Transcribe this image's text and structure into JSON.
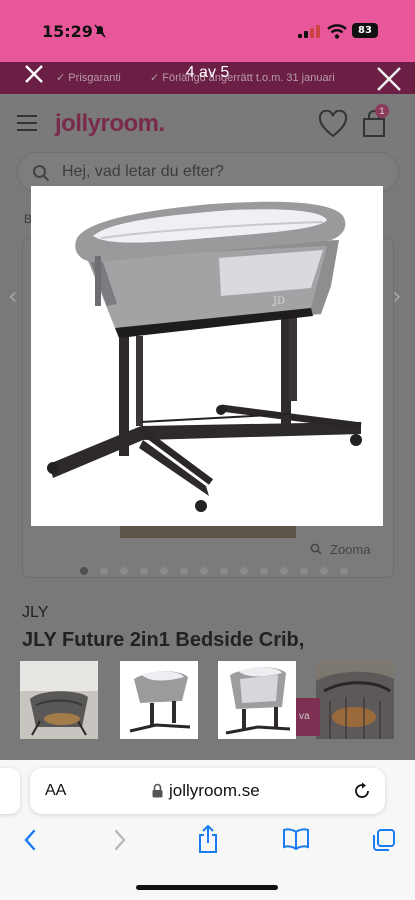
{
  "status": {
    "time": "15:29",
    "battery": "83"
  },
  "usp": {
    "item1": "✓ Prisgaranti",
    "item2": "✓ Förlängd ångerrätt t.o.m. 31 januari"
  },
  "header": {
    "logo": "jollyroom.",
    "cart_count": "1"
  },
  "search": {
    "placeholder": "Hej, vad letar du efter?"
  },
  "breadcrumb": "B",
  "gallery": {
    "zoom_label": "Zooma",
    "dot_count": 14,
    "active_dot": 0
  },
  "product": {
    "brand": "JLY",
    "title": "JLY Future 2in1 Bedside Crib,"
  },
  "lightbox": {
    "counter": "4 av 5"
  },
  "cart_peek": "va",
  "safari": {
    "aa_label": "AA",
    "url": "jollyroom.se"
  },
  "colors": {
    "status_bg": "#e8579a",
    "brand": "#7a2a4b",
    "usp_bg": "#6b1f44",
    "ios_blue": "#1a7cf2"
  },
  "icons": [
    "close-icon",
    "hamburger-icon",
    "heart-icon",
    "bag-icon",
    "search-icon",
    "chevron-left-icon",
    "chevron-right-icon",
    "lock-icon",
    "reload-icon",
    "share-icon",
    "book-icon",
    "tabs-icon"
  ]
}
